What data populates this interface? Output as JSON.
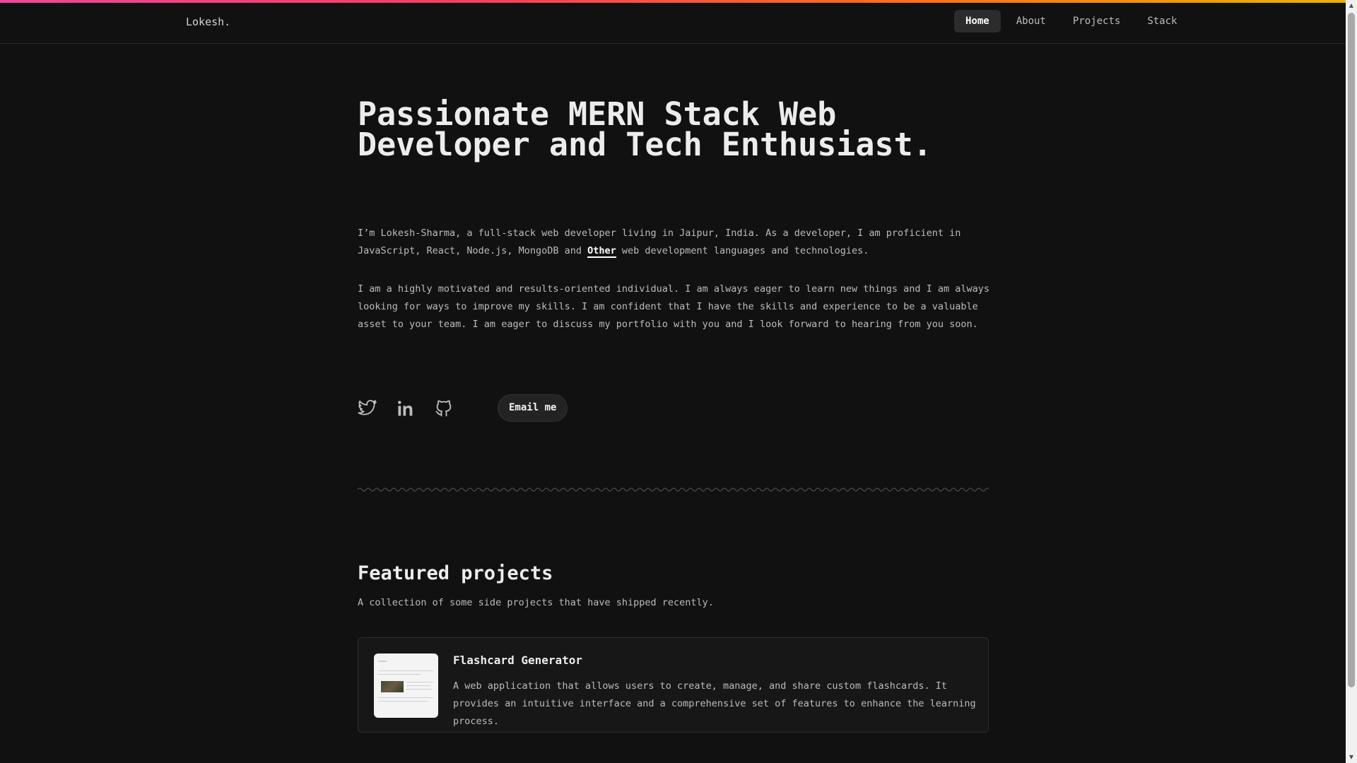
{
  "header": {
    "brand": "Lokesh.",
    "nav": [
      {
        "label": "Home",
        "active": true
      },
      {
        "label": "About",
        "active": false
      },
      {
        "label": "Projects",
        "active": false
      },
      {
        "label": "Stack",
        "active": false
      }
    ]
  },
  "hero": {
    "title_line1": "Passionate MERN Stack Web",
    "title_line2": "Developer and Tech Enthusiast.",
    "intro_before_link": "I’m Lokesh-Sharma, a full-stack web developer living in Jaipur, India. As a developer, I am proficient in JavaScript, React, Node.js, MongoDB and ",
    "intro_link": "Other",
    "intro_after_link": " web development languages and technologies.",
    "bio": "I am a highly motivated and results-oriented individual. I am always eager to learn new things and I am always looking for ways to improve my skills. I am confident that I have the skills and experience to be a valuable asset to your team. I am eager to discuss my portfolio with you and I look forward to hearing from you soon."
  },
  "socials": {
    "icons": [
      "twitter-icon",
      "linkedin-icon",
      "github-icon"
    ],
    "email_button": "Email me"
  },
  "featured": {
    "title": "Featured projects",
    "subtitle": "A collection of some side projects that have shipped recently.",
    "projects": [
      {
        "name": "Flashcard Generator",
        "description": "A web application that allows users to create, manage, and share custom flashcards. It provides an intuitive interface and a comprehensive set of features to enhance the learning process."
      }
    ]
  },
  "colors": {
    "background": "#111111",
    "accent_gradient": [
      "#ec4899",
      "#f43f5e",
      "#f97316",
      "#eab308"
    ],
    "text": "#ececec",
    "muted_text": "#bcbcbc"
  }
}
